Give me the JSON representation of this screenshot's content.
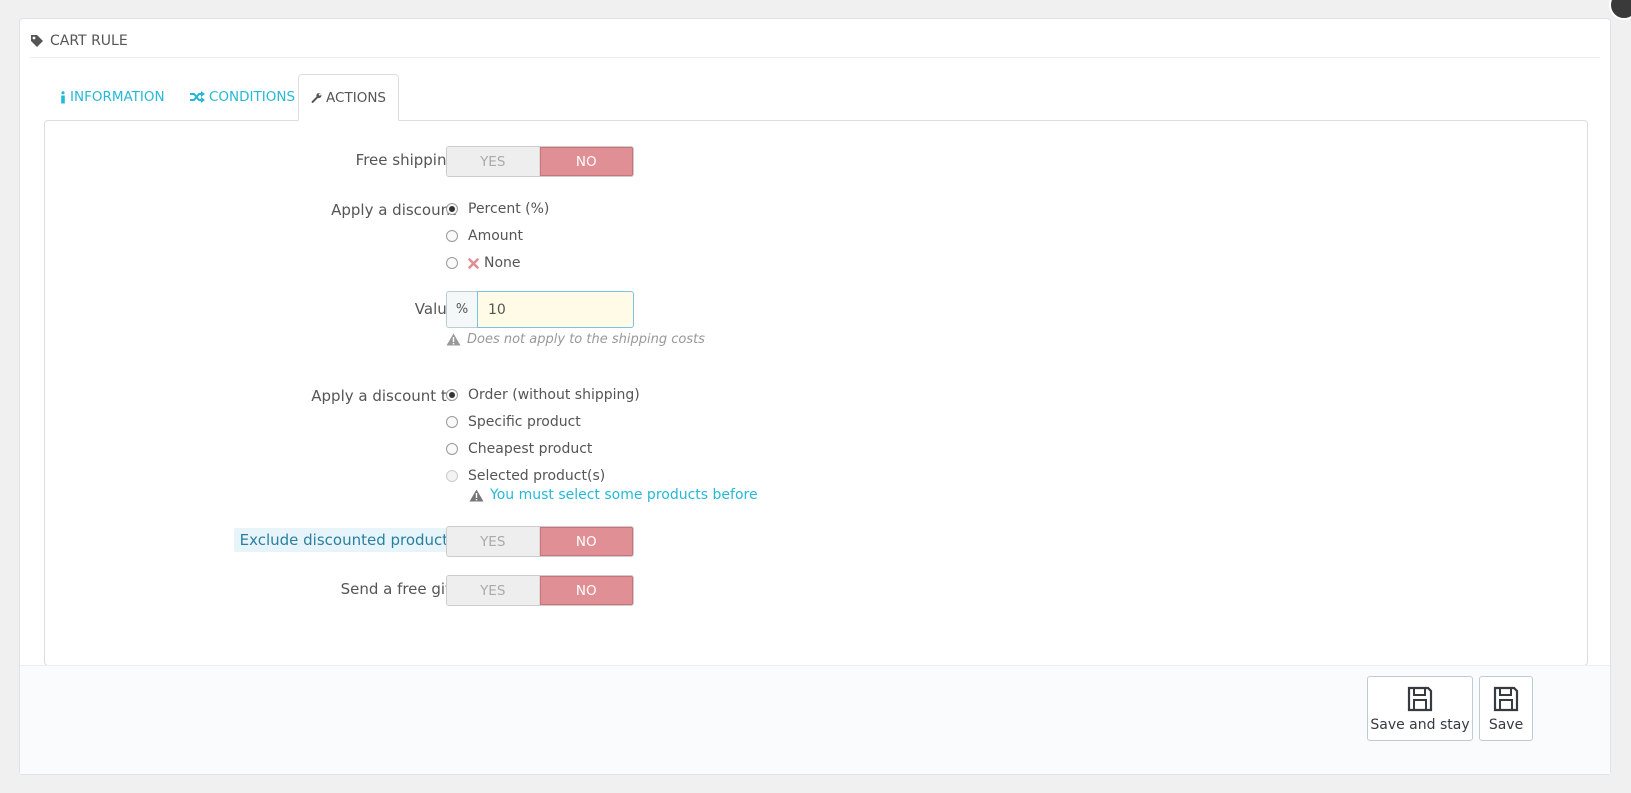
{
  "panel": {
    "title": "CART RULE",
    "title_icon": "tag-icon"
  },
  "tabs": [
    {
      "label": "INFORMATION",
      "icon": "info-icon",
      "active": false
    },
    {
      "label": "CONDITIONS",
      "icon": "shuffle-icon",
      "active": false
    },
    {
      "label": "ACTIONS",
      "icon": "wrench-icon",
      "active": true
    }
  ],
  "free_shipping": {
    "label": "Free shipping",
    "yes": "YES",
    "no": "NO",
    "value": "NO"
  },
  "apply_discount": {
    "label": "Apply a discount",
    "options": [
      "Percent (%)",
      "Amount",
      "None"
    ],
    "selected": "Percent (%)"
  },
  "value": {
    "label": "Value",
    "addon": "%",
    "input_value": "10",
    "help": "Does not apply to the shipping costs"
  },
  "apply_discount_to": {
    "label": "Apply a discount to",
    "options": [
      "Order (without shipping)",
      "Specific product",
      "Cheapest product",
      "Selected product(s)"
    ],
    "selected": "Order (without shipping)",
    "warning": "You must select some products before"
  },
  "exclude_discounted": {
    "label": "Exclude discounted products",
    "yes": "YES",
    "no": "NO",
    "value": "NO"
  },
  "free_gift": {
    "label": "Send a free gift",
    "yes": "YES",
    "no": "NO",
    "value": "NO"
  },
  "footer": {
    "save_and_stay": "Save and stay",
    "save": "Save"
  },
  "colors": {
    "accent": "#25b9d7",
    "no_active": "#e08f95",
    "input_bg": "#fffbe6"
  }
}
